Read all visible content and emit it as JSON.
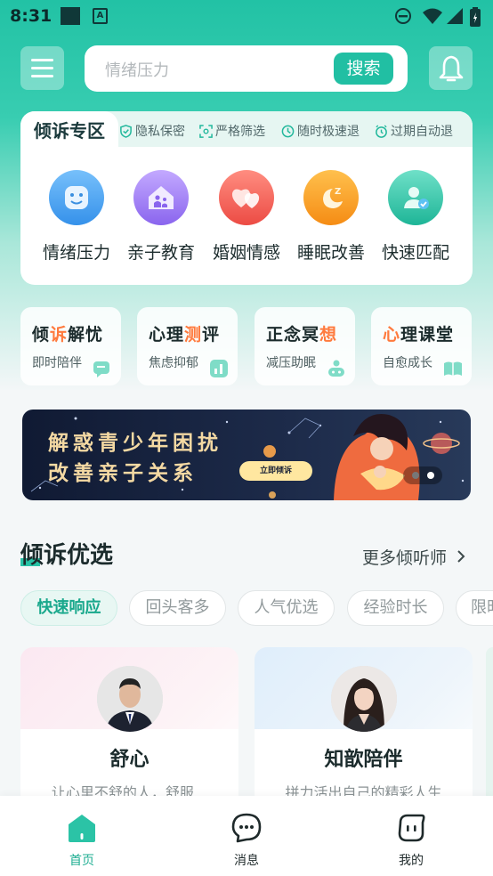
{
  "status_bar": {
    "time": "8:31",
    "app_badge": "A"
  },
  "search": {
    "placeholder": "情绪压力",
    "button_label": "搜索"
  },
  "zone": {
    "title": "倾诉专区",
    "features": [
      "隐私保密",
      "严格筛选",
      "随时极速退",
      "过期自动退"
    ],
    "categories": [
      {
        "label": "情绪压力",
        "icon": "face-icon",
        "color": "#4ba6f2"
      },
      {
        "label": "亲子教育",
        "icon": "family-home-icon",
        "color": "#9a7cf2"
      },
      {
        "label": "婚姻情感",
        "icon": "hearts-icon",
        "color": "#f2605a"
      },
      {
        "label": "睡眠改善",
        "icon": "moon-sleep-icon",
        "color": "#f7a327"
      },
      {
        "label": "快速匹配",
        "icon": "user-check-icon",
        "color": "#2ec2a7"
      }
    ]
  },
  "services": [
    {
      "title_a": "倾",
      "title_o": "诉",
      "title_b": "解忧",
      "subtitle": "即时陪伴",
      "icon": "chat-icon"
    },
    {
      "title_a": "心理",
      "title_o": "测",
      "title_b": "评",
      "subtitle": "焦虑抑郁",
      "icon": "chart-icon"
    },
    {
      "title_a": "正念冥",
      "title_o": "想",
      "title_b": "",
      "subtitle": "减压助眠",
      "icon": "meditation-icon"
    },
    {
      "title_a": "",
      "title_o": "心",
      "title_b": "理课堂",
      "subtitle": "自愈成长",
      "icon": "book-icon"
    }
  ],
  "banner": {
    "line1": "解惑青少年困扰",
    "line2": "改善亲子关系",
    "cta": "立即倾诉"
  },
  "section": {
    "title": "倾诉优选",
    "more": "更多倾听师"
  },
  "filters": [
    "快速响应",
    "回头客多",
    "人气优选",
    "经验时长",
    "限时"
  ],
  "listeners": [
    {
      "name": "舒心",
      "description": "让心里不舒的人，舒服..."
    },
    {
      "name": "知歆陪伴",
      "description": "拼力活出自己的精彩人生"
    }
  ],
  "tabbar": [
    {
      "label": "首页",
      "icon": "home-icon",
      "active": true
    },
    {
      "label": "消息",
      "icon": "message-icon",
      "active": false
    },
    {
      "label": "我的",
      "icon": "profile-icon",
      "active": false
    }
  ],
  "colors": {
    "accent": "#21bfa3",
    "highlight": "#ff7a3d",
    "banner_text": "#f4d9a3"
  }
}
